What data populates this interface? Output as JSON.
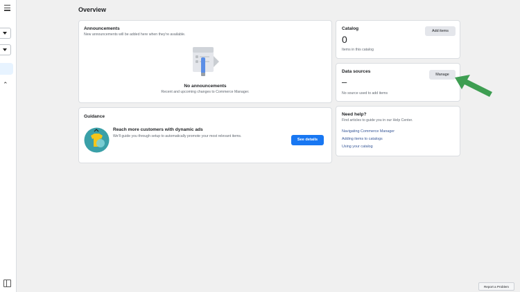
{
  "page": {
    "title": "Overview"
  },
  "announcements": {
    "title": "Announcements",
    "subtitle": "New announcements will be added here when they're available.",
    "empty_title": "No announcements",
    "empty_desc": "Recent and upcoming changes to Commerce Manager."
  },
  "guidance": {
    "title": "Guidance",
    "promo_title": "Reach more customers with dynamic ads",
    "promo_desc": "We'll guide you through setup to automatically promote your most relevant items.",
    "button": "See details"
  },
  "catalog": {
    "title": "Catalog",
    "count": "0",
    "count_label": "Items in this catalog",
    "button": "Add items"
  },
  "data_sources": {
    "title": "Data sources",
    "value": "–",
    "desc": "No source used to add items",
    "button": "Manage"
  },
  "help": {
    "title": "Need help?",
    "desc": "Find articles to guide you in our Help Center.",
    "links": [
      "Navigating Commerce Manager",
      "Adding items to catalogs",
      "Using your catalog"
    ]
  },
  "footer": {
    "report_problem": "Report a Problem"
  },
  "colors": {
    "primary": "#1877f2",
    "link": "#385898",
    "annotation_arrow": "#3e9e52"
  }
}
